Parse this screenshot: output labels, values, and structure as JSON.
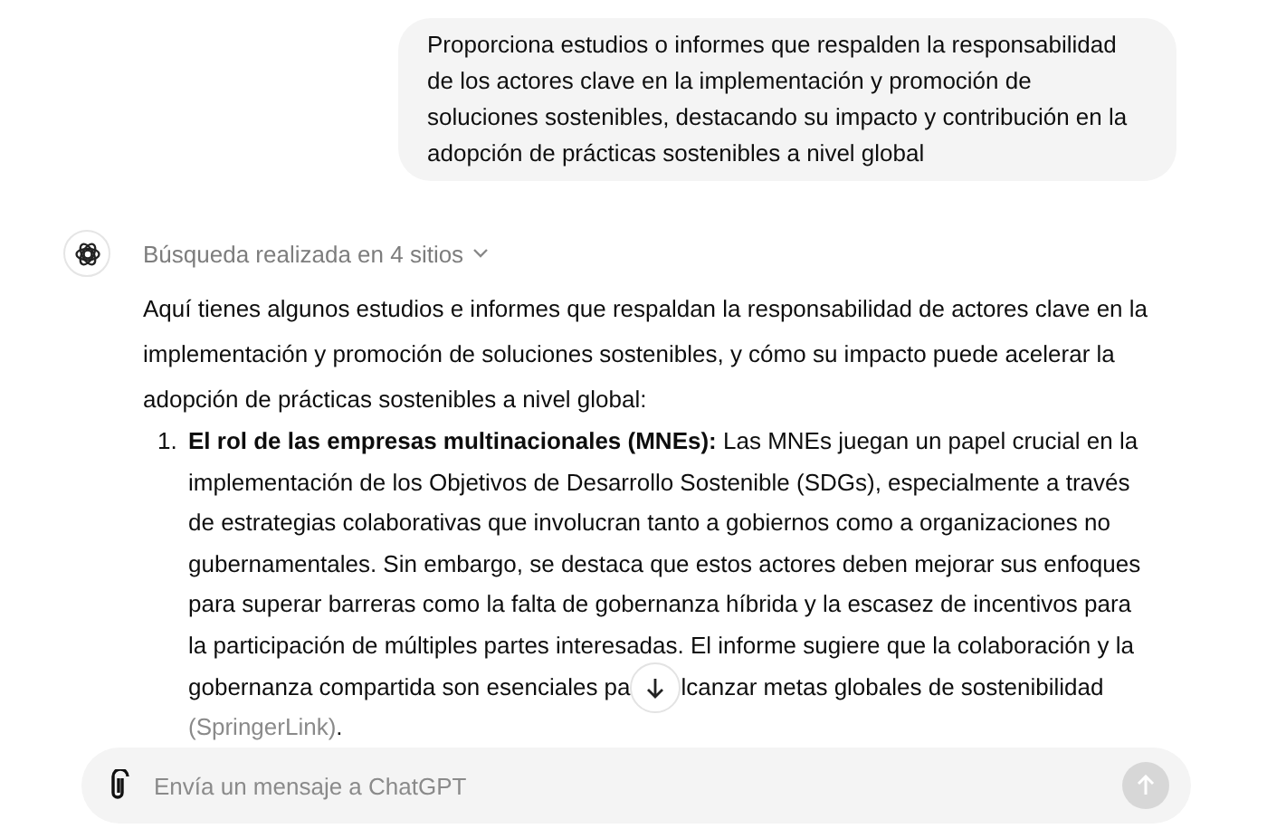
{
  "user_message": "Proporciona estudios o informes que respalden la responsabilidad de los actores clave en la implementación y promoción de soluciones sostenibles, destacando su impacto y contribución en la adopción de prácticas sostenibles a nivel global",
  "assistant": {
    "search_summary": "Búsqueda realizada en 4 sitios",
    "intro": "Aquí tienes algunos estudios e informes que respaldan la responsabilidad de actores clave en la implementación y promoción de soluciones sostenibles, y cómo su impacto puede acelerar la adopción de prácticas sostenibles a nivel global:",
    "items": [
      {
        "number": "1.",
        "title": "El rol de las empresas multinacionales (MNEs):",
        "text": "Las MNEs juegan un papel crucial en la implementación de los Objetivos de Desarrollo Sostenible (SDGs), especialmente a través de estrategias colaborativas que involucran tanto a gobiernos como a organizaciones no gubernamentales. Sin embargo, se destaca que estos actores deben mejorar sus enfoques para superar barreras como la falta de gobernanza híbrida y la escasez de incentivos para la participación de múltiples partes interesadas. El informe sugiere que la colaboración y la gobernanza compartida son esenciales pa",
        "text_after_button": "lcanzar metas globales de sostenibilidad",
        "source": "(SpringerLink)",
        "tail": "."
      }
    ]
  },
  "composer": {
    "placeholder": "Envía un mensaje a ChatGPT"
  }
}
